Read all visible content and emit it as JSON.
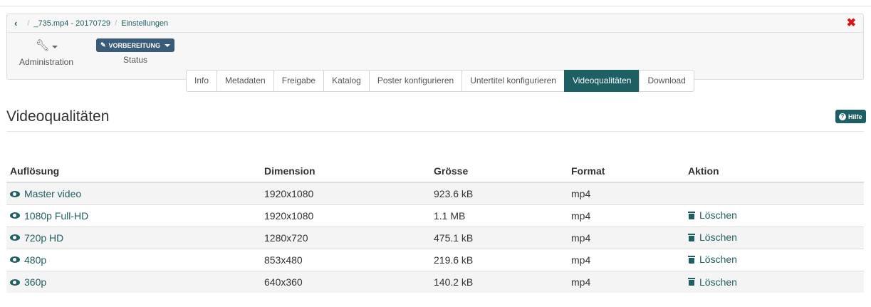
{
  "breadcrumb": {
    "items": [
      "_735.mp4 - 20170729",
      "Einstellungen"
    ]
  },
  "toolbar": {
    "admin_label": "Administration",
    "status_button": "VORBEREITUNG",
    "status_label": "Status"
  },
  "tabs": [
    {
      "label": "Info",
      "active": false
    },
    {
      "label": "Metadaten",
      "active": false
    },
    {
      "label": "Freigabe",
      "active": false
    },
    {
      "label": "Katalog",
      "active": false
    },
    {
      "label": "Poster konfigurieren",
      "active": false
    },
    {
      "label": "Untertitel konfigurieren",
      "active": false
    },
    {
      "label": "Videoqualitäten",
      "active": true
    },
    {
      "label": "Download",
      "active": false
    }
  ],
  "page": {
    "title": "Videoqualitäten",
    "help_label": "Hilfe"
  },
  "table": {
    "headers": [
      "Auflösung",
      "Dimension",
      "Grösse",
      "Format",
      "Aktion"
    ],
    "rows": [
      {
        "resolution": "Master video",
        "dimension": "1920x1080",
        "size": "923.6 kB",
        "format": "mp4",
        "action": ""
      },
      {
        "resolution": "1080p Full-HD",
        "dimension": "1920x1080",
        "size": "1.1 MB",
        "format": "mp4",
        "action": "Löschen"
      },
      {
        "resolution": "720p HD",
        "dimension": "1280x720",
        "size": "475.1 kB",
        "format": "mp4",
        "action": "Löschen"
      },
      {
        "resolution": "480p",
        "dimension": "853x480",
        "size": "219.6 kB",
        "format": "mp4",
        "action": "Löschen"
      },
      {
        "resolution": "360p",
        "dimension": "640x360",
        "size": "140.2 kB",
        "format": "mp4",
        "action": "Löschen"
      }
    ]
  },
  "colors": {
    "accent": "#1e5f63",
    "status_button": "#3b5c78",
    "close": "#d9141a"
  },
  "icons": [
    "back-icon",
    "close-icon",
    "wrench-icon",
    "pencil-icon",
    "help-icon",
    "eye-icon",
    "trash-icon"
  ]
}
